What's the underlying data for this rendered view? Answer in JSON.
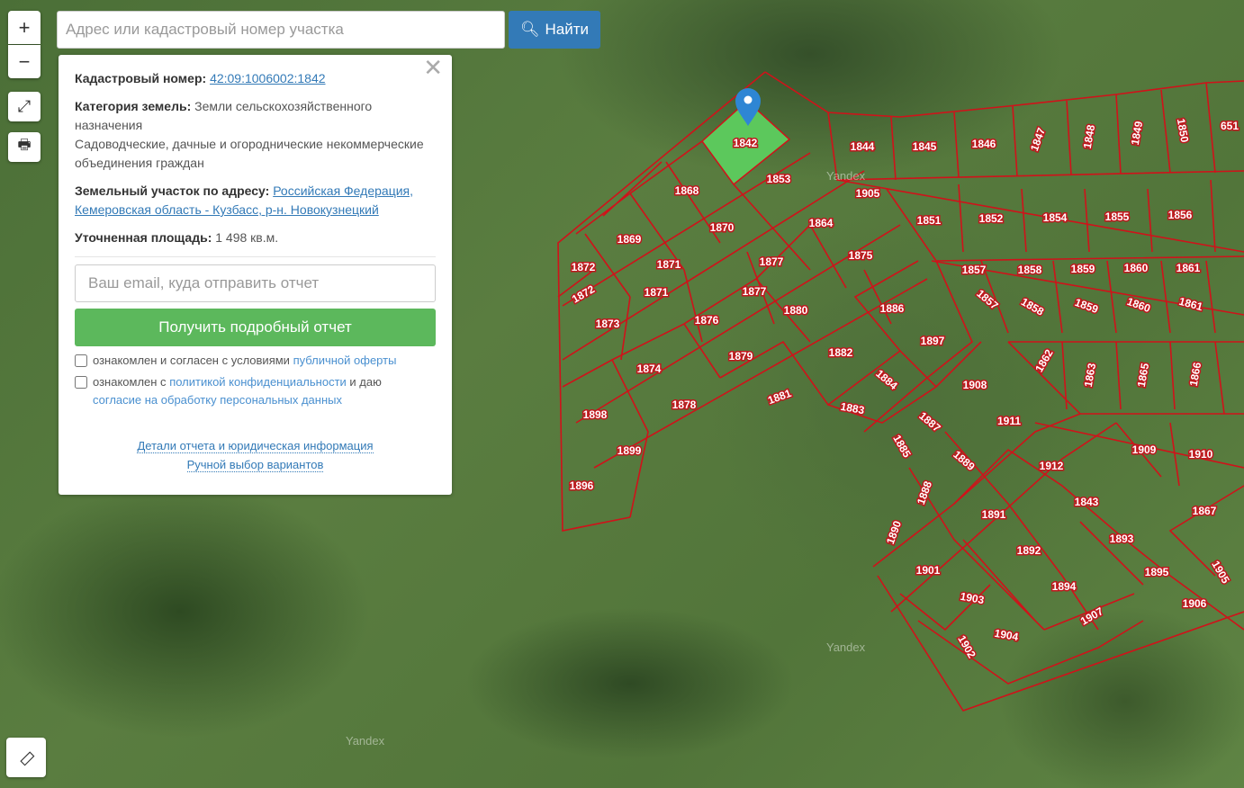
{
  "search": {
    "placeholder": "Адрес или кадастровый номер участка",
    "button": "Найти"
  },
  "controls": {
    "zoom_in": "+",
    "zoom_out": "−"
  },
  "panel": {
    "cadastral_label": "Кадастровый номер:",
    "cadastral_value": "42:09:1006002:1842",
    "category_label": "Категория земель:",
    "category_value": "Земли сельскохозяйственного назначения",
    "usage": "Садоводческие, дачные и огороднические некоммерческие объединения граждан",
    "address_label": "Земельный участок по адресу:",
    "address_value": "Российская Федерация, Кемеровская область - Кузбасс, р-н. Новокузнецкий",
    "area_label": "Уточненная площадь:",
    "area_value": "1 498 кв.м.",
    "email_placeholder": "Ваш email, куда отправить отчет",
    "report_button": "Получить подробный отчет",
    "consent1_text": "ознакомлен и согласен с условиями ",
    "consent1_link": "публичной оферты",
    "consent2_text": "ознакомлен с ",
    "consent2_link": "политикой конфиденциальности",
    "consent2_mid": " и даю ",
    "consent2_link2": "согласие на обработку персональных данных",
    "link_details": "Детали отчета и юридическая информация",
    "link_manual": "Ручной выбор вариантов"
  },
  "watermark": "Yandex",
  "selected_parcel": "1842",
  "colors": {
    "parcel_border": "#d0121a",
    "selected": "#5cc85c",
    "accent": "#337ab7",
    "button_green": "#5cb85c"
  },
  "parcels": [
    "1844",
    "1845",
    "1846",
    "1847",
    "1848",
    "1849",
    "1850",
    "651",
    "1853",
    "1868",
    "1905",
    "1851",
    "1852",
    "1854",
    "1855",
    "1856",
    "1864",
    "1870",
    "1869",
    "1875",
    "1877",
    "1871",
    "1872",
    "1872",
    "1871",
    "1877",
    "1857",
    "1858",
    "1859",
    "1860",
    "1861",
    "1857",
    "1858",
    "1859",
    "1860",
    "1861",
    "1873",
    "1876",
    "1880",
    "1886",
    "1897",
    "1882",
    "1879",
    "1874",
    "1862",
    "1863",
    "1865",
    "1866",
    "1884",
    "1908",
    "1881",
    "1878",
    "1883",
    "1898",
    "1911",
    "1887",
    "1885",
    "1909",
    "1910",
    "1899",
    "1889",
    "1912",
    "1896",
    "1888",
    "1843",
    "1867",
    "1891",
    "1890",
    "1893",
    "1892",
    "1901",
    "1895",
    "1905",
    "1894",
    "1903",
    "1906",
    "1907",
    "1904",
    "1902"
  ]
}
